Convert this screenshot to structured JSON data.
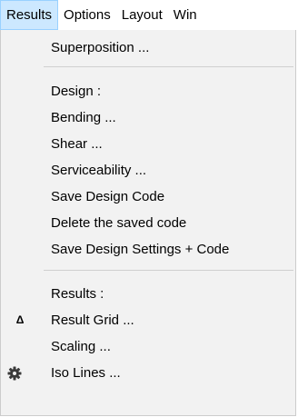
{
  "menubar": {
    "items": [
      {
        "label": "Results",
        "active": true
      },
      {
        "label": "Options"
      },
      {
        "label": "Layout"
      },
      {
        "label": "Win"
      }
    ]
  },
  "results_menu": {
    "superposition": "Superposition ...",
    "design_header": "Design :",
    "bending": "Bending ...",
    "shear": "Shear ...",
    "serviceability": "Serviceability ...",
    "save_design_code": "Save Design Code",
    "delete_saved_code": "Delete the saved code",
    "save_design_settings": "Save Design Settings + Code",
    "results_header": "Results :",
    "result_grid": "Result Grid ...",
    "result_grid_icon": "Δ",
    "scaling": "Scaling ...",
    "iso_lines": "Iso Lines ...",
    "iso_lines_icon": "gear-icon"
  },
  "colors": {
    "active_menu_bg": "#cce8ff",
    "active_menu_border": "#99d1ff",
    "dropdown_bg": "#f2f2f2"
  }
}
